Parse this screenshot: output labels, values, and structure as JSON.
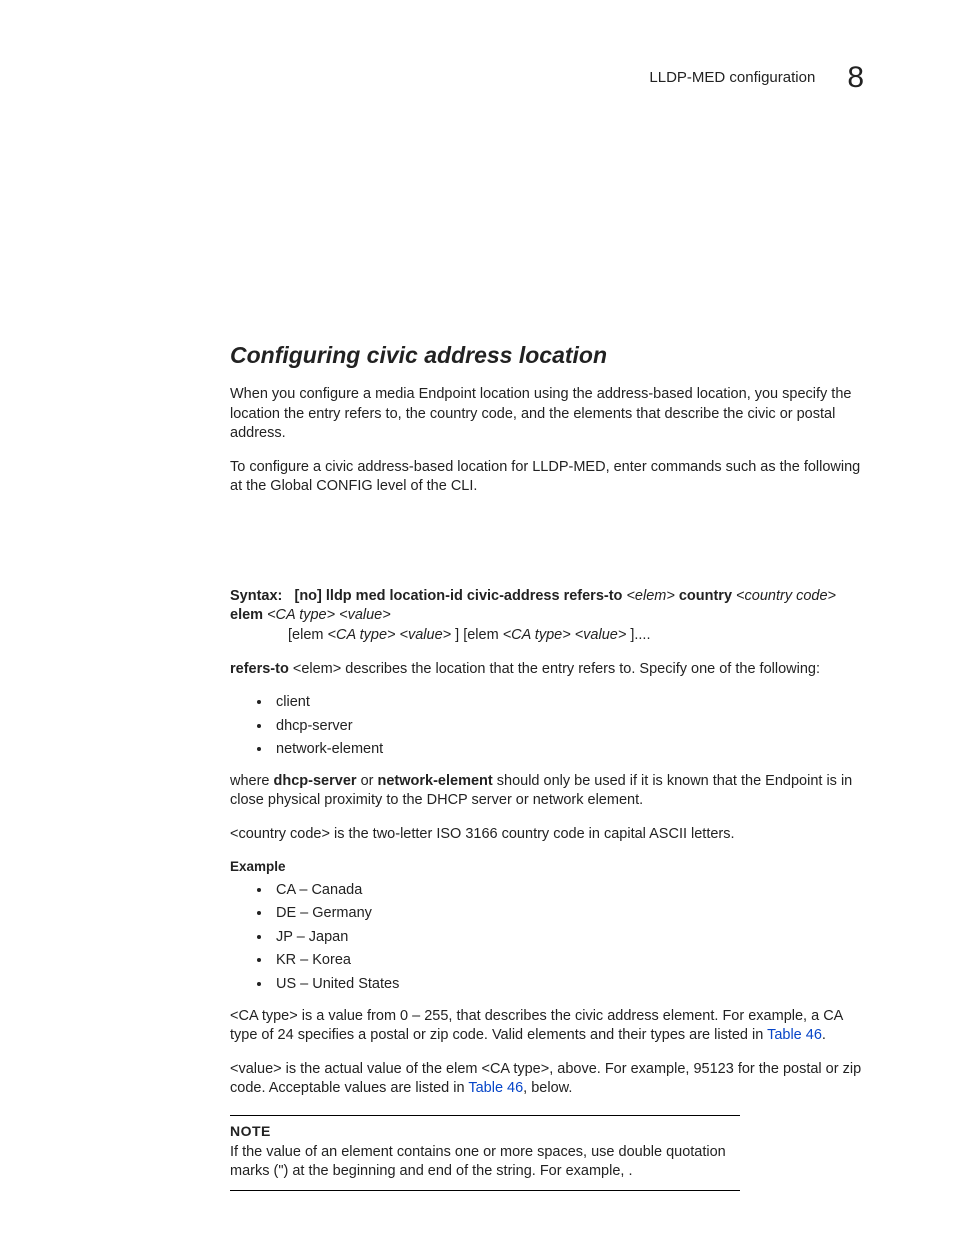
{
  "header": {
    "running_title": "LLDP-MED configuration",
    "chapter_number": "8"
  },
  "section_heading": "Configuring civic address location",
  "para1": "When you configure a media Endpoint location using the address-based location, you specify the location the entry refers to, the country code, and the elements that describe the civic or postal address.",
  "para2": "To configure a civic address-based location for LLDP-MED, enter commands such as the following at the Global CONFIG level of the CLI.",
  "syntax": {
    "label": "Syntax:",
    "line1_parts": {
      "a": "[no] lldp med location-id civic-address refers-to",
      "b": "<elem>",
      "c": "country",
      "d": "<country code>",
      "e": "elem",
      "f": "<CA type> <value>",
      "g": "[elem",
      "h": "<CA type> <value>",
      "i": "] [elem",
      "j": "<CA type> <value>",
      "k": "]...."
    }
  },
  "refers_to_label": "refers-to",
  "refers_to_text": " <elem> describes the location that the entry refers to.  Specify one of the following:",
  "refers_list": [
    "client",
    "dhcp-server",
    "network-element"
  ],
  "where_text_a": "where ",
  "where_b1": "dhcp-server",
  "where_mid": " or ",
  "where_b2": "network-element",
  "where_text_b": " should only be used if it is known that the Endpoint is in close physical proximity to the DHCP server or network element.",
  "country_code_text": "<country code> is the two-letter ISO 3166 country code in capital ASCII letters.",
  "example_label": "Example",
  "example_list": [
    "CA – Canada",
    "DE – Germany",
    "JP – Japan",
    "KR – Korea",
    "US – United States"
  ],
  "ca_type_a": "<CA type> is a value from 0 – 255, that describes the civic address element.  For example, a CA type of 24 specifies a postal or zip code.  Valid elements and their types are listed in ",
  "link1": "Table 46",
  "ca_type_b": ".",
  "value_a": "<value> is the actual value of the elem <CA type>, above.  For example, 95123 for the postal or zip code.  Acceptable values are listed in ",
  "link2": "Table 46",
  "value_b": ", below.",
  "note": {
    "label": "NOTE",
    "text": "If the value of an element contains one or more spaces, use double quotation marks (\") at the beginning and end of the string.  For example,                                                                     ."
  }
}
